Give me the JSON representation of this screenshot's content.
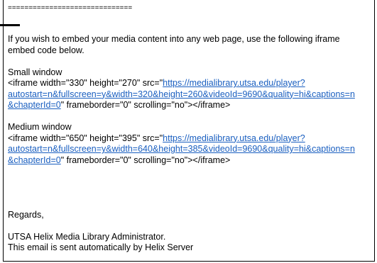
{
  "email": {
    "separator": "==============================",
    "intro": [
      "If you wish to embed your media content into any web page, use the following iframe",
      "embed code below."
    ],
    "small": {
      "heading": "Small window",
      "prefix": "<iframe width=\"330\" height=\"270\" src=\"",
      "link_line1": "https://medialibrary.utsa.edu/player?",
      "link_line2": "autostart=n&fullscreen=y&width=320&height=260&videoId=9690&quality=hi&captions=n",
      "link_line3": "&chapterId=0",
      "suffix": "\" frameborder=\"0\" scrolling=\"no\"></iframe>"
    },
    "medium": {
      "heading": "Medium window",
      "prefix": "<iframe width=\"650\" height=\"395\" src=\"",
      "link_line1": "https://medialibrary.utsa.edu/player?",
      "link_line2": "autostart=n&fullscreen=y&width=640&height=385&videoId=9690&quality=hi&captions=n",
      "link_line3": "&chapterId=0",
      "suffix": "\" frameborder=\"0\" scrolling=\"no\"></iframe>"
    },
    "regards": "Regards,",
    "signature": [
      "UTSA Helix Media Library Administrator.",
      "This email is sent automatically by Helix Server"
    ]
  }
}
